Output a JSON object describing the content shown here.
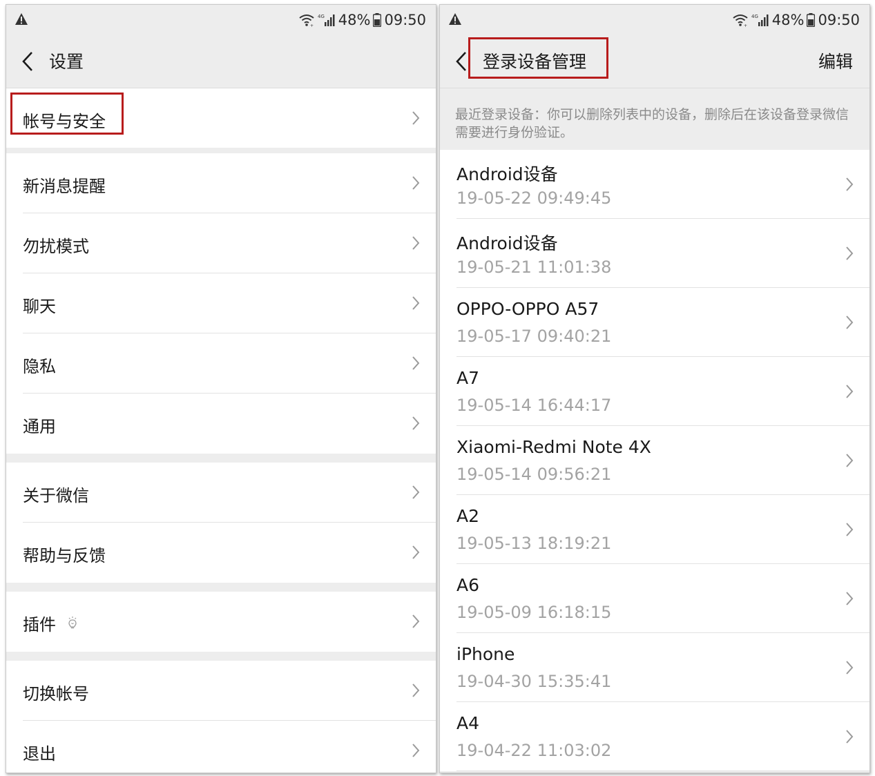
{
  "status_bar": {
    "network": "4G",
    "battery": "48%",
    "time": "09:50"
  },
  "settings_screen": {
    "title": "设置",
    "items": [
      {
        "label": "帐号与安全"
      },
      {
        "label": "新消息提醒"
      },
      {
        "label": "勿扰模式"
      },
      {
        "label": "聊天"
      },
      {
        "label": "隐私"
      },
      {
        "label": "通用"
      },
      {
        "label": "关于微信"
      },
      {
        "label": "帮助与反馈"
      },
      {
        "label": "插件"
      },
      {
        "label": "切换帐号"
      },
      {
        "label": "退出"
      }
    ],
    "highlighted_item": "帐号与安全"
  },
  "devices_screen": {
    "title": "登录设备管理",
    "edit_label": "编辑",
    "info": "最近登录设备：你可以删除列表中的设备，删除后在该设备登录微信需要进行身份验证。",
    "devices": [
      {
        "name": "Android设备",
        "time": "19-05-22 09:49:45"
      },
      {
        "name": "Android设备",
        "time": "19-05-21 11:01:38"
      },
      {
        "name": "OPPO-OPPO A57",
        "time": "19-05-17 09:40:21"
      },
      {
        "name": "A7",
        "time": "19-05-14 16:44:17"
      },
      {
        "name": "Xiaomi-Redmi Note 4X",
        "time": "19-05-14 09:56:21"
      },
      {
        "name": "A2",
        "time": "19-05-13 18:19:21"
      },
      {
        "name": "A6",
        "time": "19-05-09 16:18:15"
      },
      {
        "name": "iPhone",
        "time": "19-04-30 15:35:41"
      },
      {
        "name": "A4",
        "time": "19-04-22 11:03:02"
      }
    ],
    "highlighted_item": "登录设备管理"
  },
  "colors": {
    "highlight": "#b81c1c",
    "page_bg": "#ededed",
    "row_bg": "#ffffff",
    "secondary_text": "#a3a3a3"
  },
  "icons": [
    "warning-icon",
    "wifi-icon",
    "signal-icon",
    "battery-icon",
    "back-arrow-icon",
    "chevron-right-icon",
    "plugin-bulb-icon"
  ]
}
